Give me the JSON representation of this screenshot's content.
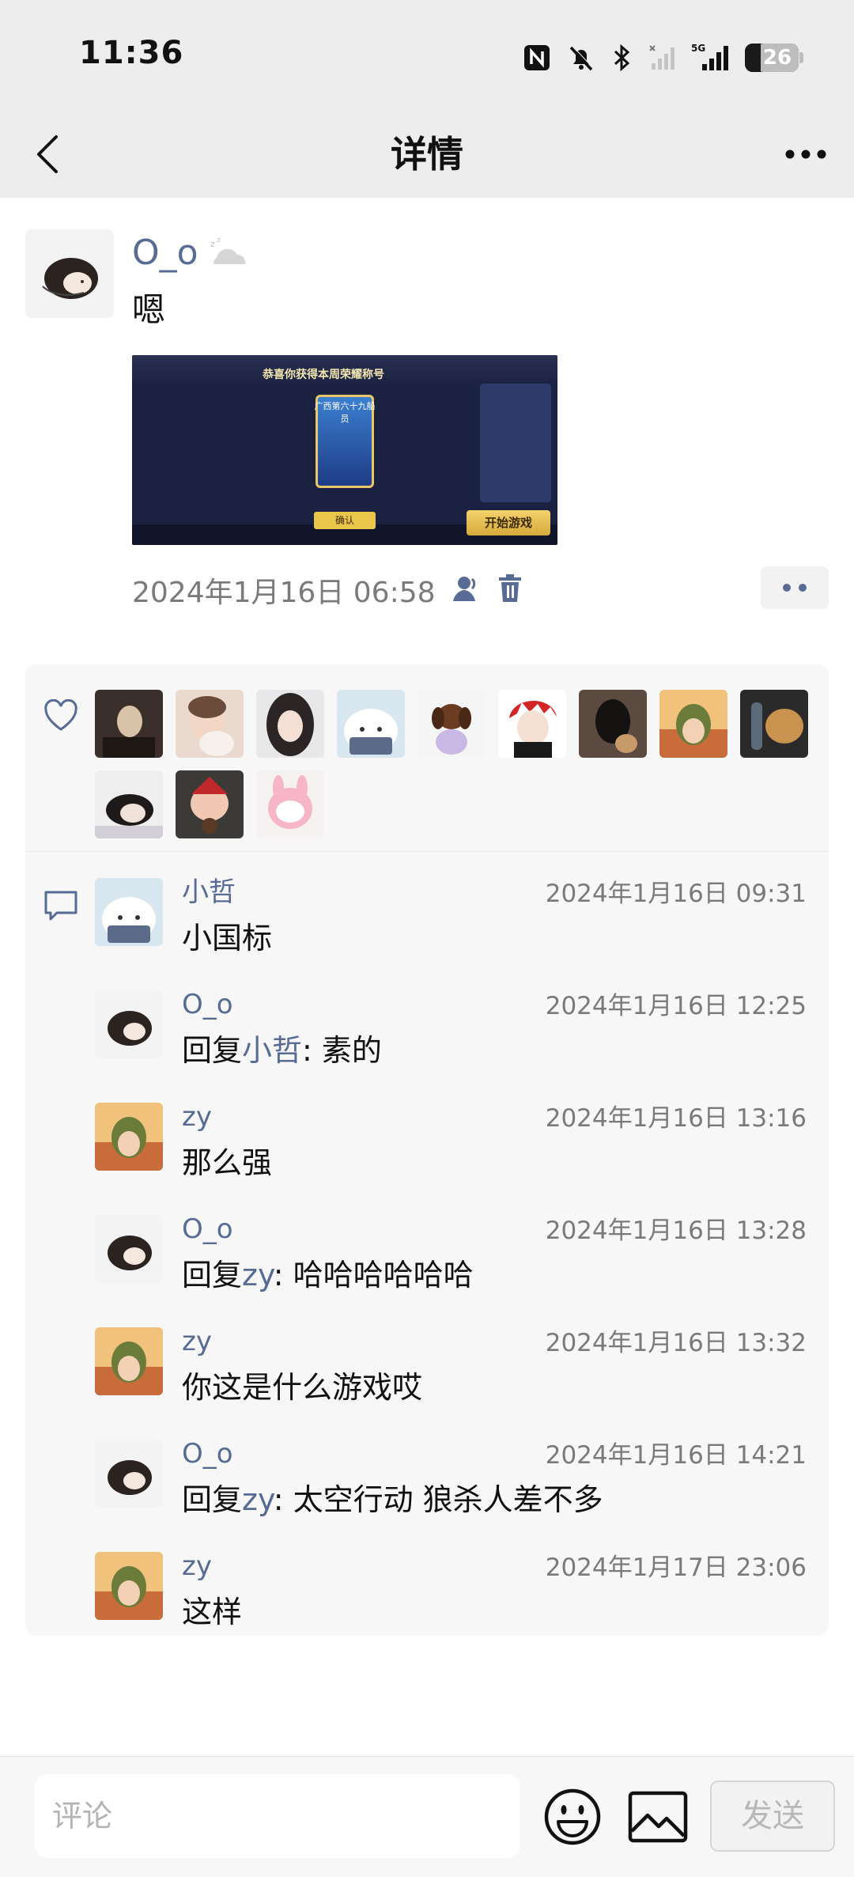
{
  "status_bar": {
    "time": "11:36",
    "battery": "26"
  },
  "nav": {
    "title": "详情"
  },
  "post": {
    "author": "O_o",
    "text": "嗯",
    "timestamp": "2024年1月16日 06:58",
    "image": {
      "banner": "恭喜你获得本周荣耀称号",
      "card_title": "广西第六十九船员",
      "confirm_label": "确认",
      "start_label": "开始游戏"
    }
  },
  "likes": {
    "count": 12
  },
  "comments": [
    {
      "name": "小哲",
      "time": "2024年1月16日 09:31",
      "text": "小国标",
      "reply_to": ""
    },
    {
      "name": "O_o",
      "time": "2024年1月16日 12:25",
      "prefix": "回复",
      "reply_to": "小哲",
      "text": ": 素的"
    },
    {
      "name": "zy",
      "time": "2024年1月16日 13:16",
      "text": "那么强",
      "reply_to": ""
    },
    {
      "name": "O_o",
      "time": "2024年1月16日 13:28",
      "prefix": "回复",
      "reply_to": "zy",
      "text": ": 哈哈哈哈哈哈"
    },
    {
      "name": "zy",
      "time": "2024年1月16日 13:32",
      "text": "你这是什么游戏哎",
      "reply_to": ""
    },
    {
      "name": "O_o",
      "time": "2024年1月16日 14:21",
      "prefix": "回复",
      "reply_to": "zy",
      "text": ": 太空行动 狼杀人差不多"
    },
    {
      "name": "zy",
      "time": "2024年1月17日 23:06",
      "text": "这样",
      "reply_to": ""
    }
  ],
  "input": {
    "placeholder": "评论",
    "send_label": "发送"
  },
  "colors": {
    "link": "#576b95",
    "header_bg": "#ededed",
    "panel_bg": "#f7f7f7"
  },
  "icons": {
    "back": "back-arrow-icon",
    "more": "more-dots-icon",
    "like": "heart-icon",
    "comment": "comment-bubble-icon",
    "emoji": "emoji-icon",
    "image": "image-icon",
    "visibility": "person-icon",
    "delete": "trash-icon",
    "sleep": "sleep-status-icon"
  }
}
